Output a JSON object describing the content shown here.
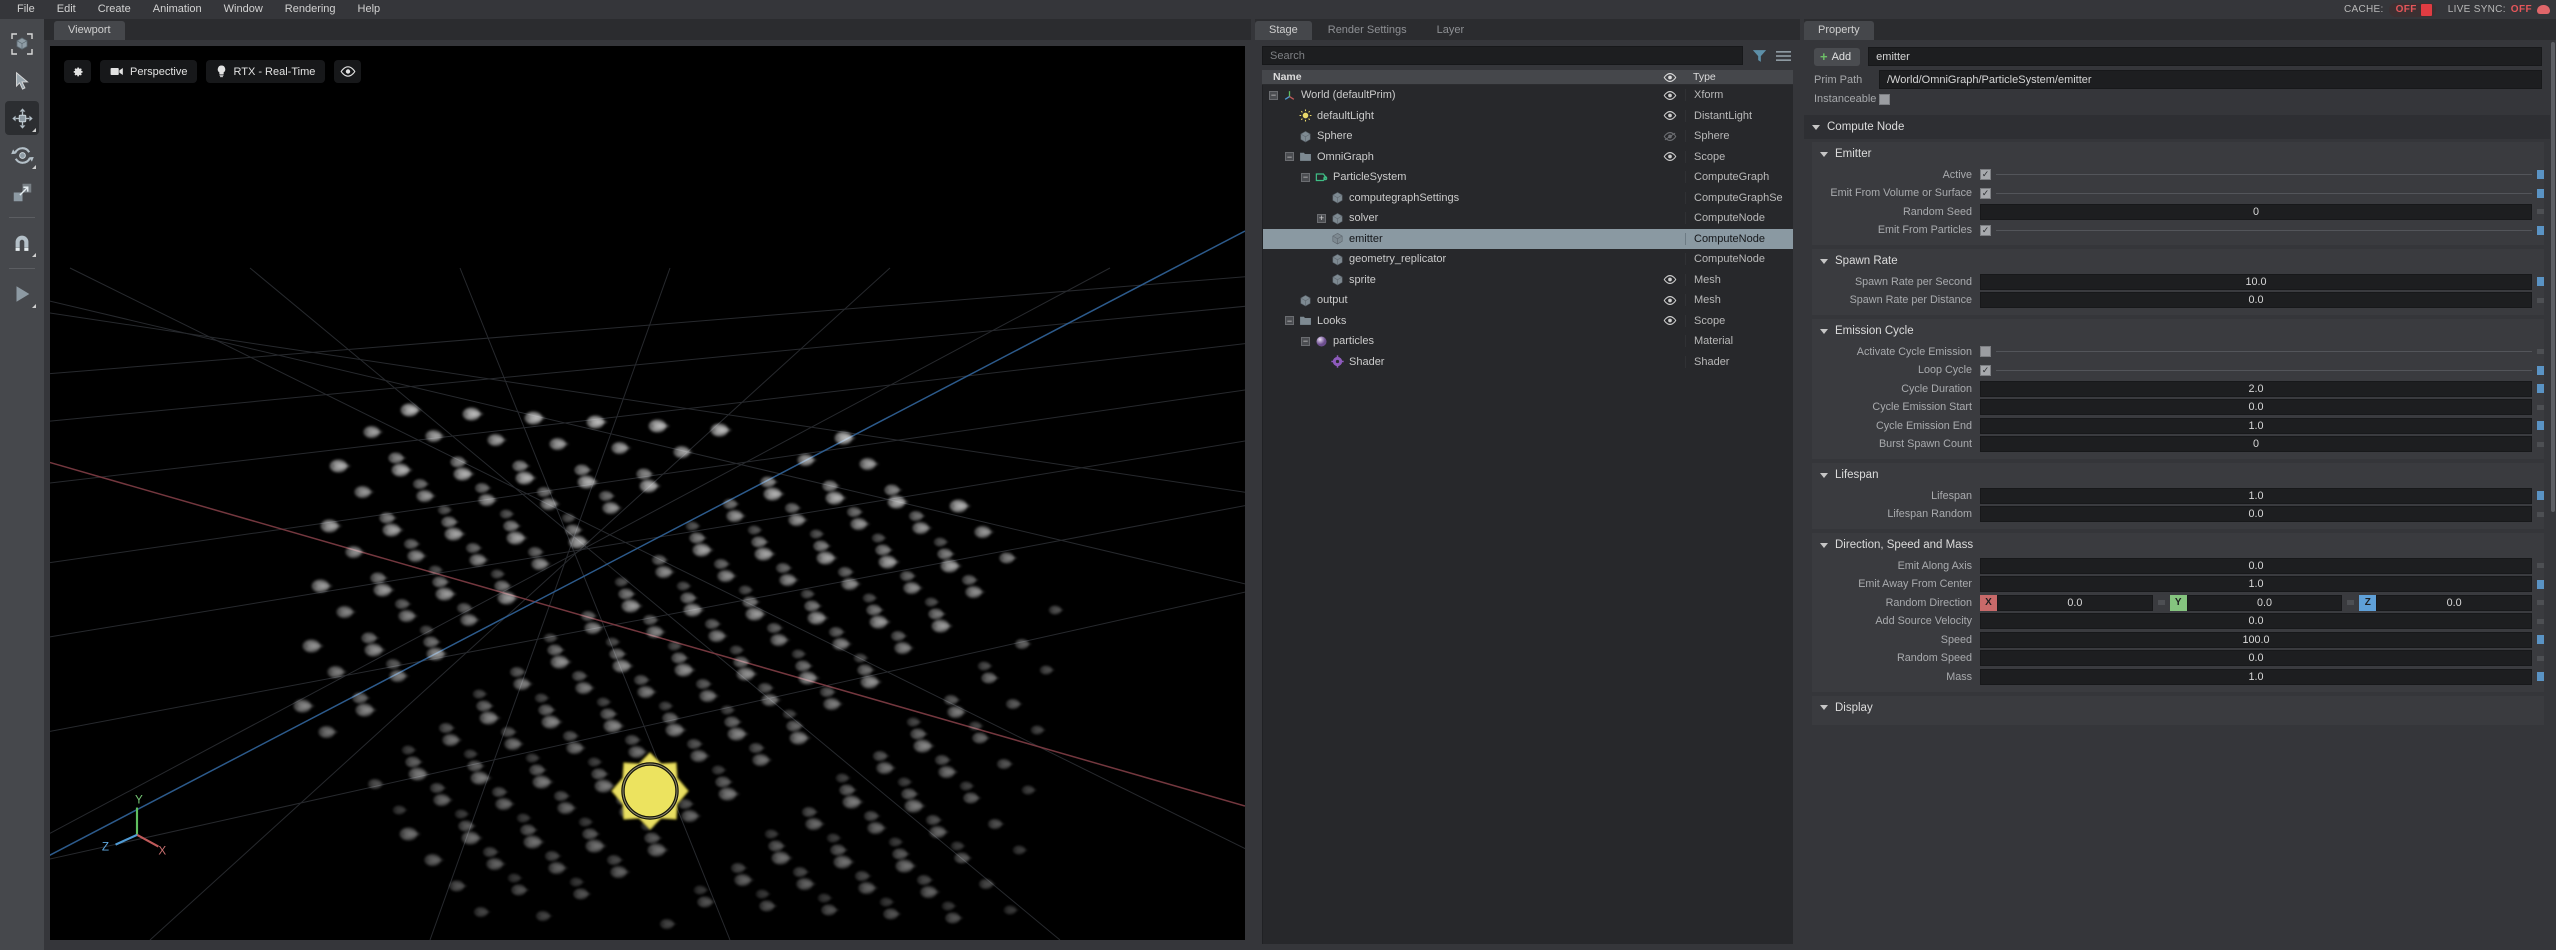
{
  "menubar": {
    "items": [
      "File",
      "Edit",
      "Create",
      "Animation",
      "Window",
      "Rendering",
      "Help"
    ],
    "cache_label": "CACHE:",
    "cache_value": "OFF",
    "livesync_label": "LIVE SYNC:",
    "livesync_value": "OFF"
  },
  "viewport": {
    "tab": "Viewport",
    "toolbar": {
      "settings_icon": "gear-icon",
      "camera_label": "Perspective",
      "renderer_label": "RTX - Real-Time",
      "visibility_icon": "eye-icon"
    },
    "axis": {
      "x": "X",
      "y": "Y",
      "z": "Z"
    }
  },
  "rail": {
    "items": [
      {
        "name": "select-bounds-tool",
        "icon": "cube-bracket-icon"
      },
      {
        "name": "pointer-tool",
        "icon": "cursor-arrow-icon"
      },
      {
        "name": "move-tool",
        "icon": "move-gizmo-icon"
      },
      {
        "name": "rotate-tool",
        "icon": "rotate-gizmo-icon"
      },
      {
        "name": "scale-tool",
        "icon": "scale-gizmo-icon"
      },
      {
        "name": "snap-tool",
        "icon": "magnet-icon"
      },
      {
        "name": "play-tool",
        "icon": "play-icon"
      }
    ]
  },
  "stage": {
    "tabs": [
      {
        "label": "Stage",
        "active": true
      },
      {
        "label": "Render Settings",
        "active": false
      },
      {
        "label": "Layer",
        "active": false
      }
    ],
    "search": {
      "placeholder": "Search",
      "value": ""
    },
    "filter_icon": "filter-funnel-icon",
    "options_icon": "hamburger-menu-icon",
    "columns": {
      "name": "Name",
      "eye": "eye-icon",
      "type": "Type"
    },
    "rows": [
      {
        "label": "World (defaultPrim)",
        "type": "Xform",
        "indent": 0,
        "expander": "minus",
        "icon": "axis-tripod-icon",
        "eye": "visible",
        "selected": false
      },
      {
        "label": "defaultLight",
        "type": "DistantLight",
        "indent": 1,
        "expander": "none",
        "icon": "light-icon",
        "eye": "visible",
        "selected": false
      },
      {
        "label": "Sphere",
        "type": "Sphere",
        "indent": 1,
        "expander": "none",
        "icon": "mesh-cube-icon",
        "eye": "hidden",
        "selected": false
      },
      {
        "label": "OmniGraph",
        "type": "Scope",
        "indent": 1,
        "expander": "minus",
        "icon": "folder-icon",
        "eye": "visible",
        "selected": false
      },
      {
        "label": "ParticleSystem",
        "type": "ComputeGraph",
        "indent": 2,
        "expander": "minus",
        "icon": "graph-icon",
        "eye": "none",
        "selected": false
      },
      {
        "label": "computegraphSettings",
        "type": "ComputeGraphSe",
        "indent": 3,
        "expander": "none",
        "icon": "mesh-cube-icon",
        "eye": "none",
        "selected": false
      },
      {
        "label": "solver",
        "type": "ComputeNode",
        "indent": 3,
        "expander": "plus",
        "icon": "mesh-cube-icon",
        "eye": "none",
        "selected": false
      },
      {
        "label": "emitter",
        "type": "ComputeNode",
        "indent": 3,
        "expander": "none",
        "icon": "mesh-cube-icon",
        "eye": "none",
        "selected": true
      },
      {
        "label": "geometry_replicator",
        "type": "ComputeNode",
        "indent": 3,
        "expander": "none",
        "icon": "mesh-cube-icon",
        "eye": "none",
        "selected": false
      },
      {
        "label": "sprite",
        "type": "Mesh",
        "indent": 3,
        "expander": "none",
        "icon": "mesh-cube-icon",
        "eye": "visible",
        "selected": false
      },
      {
        "label": "output",
        "type": "Mesh",
        "indent": 1,
        "expander": "none",
        "icon": "mesh-cube-icon",
        "eye": "visible",
        "selected": false
      },
      {
        "label": "Looks",
        "type": "Scope",
        "indent": 1,
        "expander": "minus",
        "icon": "folder-icon",
        "eye": "visible",
        "selected": false
      },
      {
        "label": "particles",
        "type": "Material",
        "indent": 2,
        "expander": "minus",
        "icon": "material-sphere-icon",
        "eye": "none",
        "selected": false
      },
      {
        "label": "Shader",
        "type": "Shader",
        "indent": 3,
        "expander": "none",
        "icon": "shader-gear-icon",
        "eye": "none",
        "selected": false
      }
    ]
  },
  "property": {
    "tab": "Property",
    "add_button": "Add",
    "name_value": "emitter",
    "prim_path_label": "Prim Path",
    "prim_path_value": "/World/OmniGraph/ParticleSystem/emitter",
    "instanceable_label": "Instanceable",
    "instanceable_checked": false,
    "compute_node_title": "Compute Node",
    "sections": [
      {
        "title": "Emitter",
        "rows": [
          {
            "label": "Active",
            "kind": "bool",
            "value": true,
            "connected": true
          },
          {
            "label": "Emit From Volume or Surface",
            "kind": "bool",
            "value": true,
            "connected": true
          },
          {
            "label": "Random Seed",
            "kind": "number",
            "value": "0",
            "connected": false
          },
          {
            "label": "Emit From Particles",
            "kind": "bool",
            "value": true,
            "connected": true
          }
        ]
      },
      {
        "title": "Spawn Rate",
        "rows": [
          {
            "label": "Spawn Rate per Second",
            "kind": "number",
            "value": "10.0",
            "connected": true
          },
          {
            "label": "Spawn Rate per Distance",
            "kind": "number",
            "value": "0.0",
            "connected": false
          }
        ]
      },
      {
        "title": "Emission Cycle",
        "rows": [
          {
            "label": "Activate Cycle Emission",
            "kind": "bool",
            "value": false,
            "connected": false
          },
          {
            "label": "Loop Cycle",
            "kind": "bool",
            "value": true,
            "connected": true
          },
          {
            "label": "Cycle Duration",
            "kind": "number",
            "value": "2.0",
            "connected": true
          },
          {
            "label": "Cycle Emission Start",
            "kind": "number",
            "value": "0.0",
            "connected": false
          },
          {
            "label": "Cycle Emission End",
            "kind": "number",
            "value": "1.0",
            "connected": true
          },
          {
            "label": "Burst Spawn Count",
            "kind": "number",
            "value": "0",
            "connected": false
          }
        ]
      },
      {
        "title": "Lifespan",
        "rows": [
          {
            "label": "Lifespan",
            "kind": "number",
            "value": "1.0",
            "connected": true
          },
          {
            "label": "Lifespan Random",
            "kind": "number",
            "value": "0.0",
            "connected": false
          }
        ]
      },
      {
        "title": "Direction, Speed and Mass",
        "rows": [
          {
            "label": "Emit Along Axis",
            "kind": "number",
            "value": "0.0",
            "connected": false
          },
          {
            "label": "Emit Away From Center",
            "kind": "number",
            "value": "1.0",
            "connected": true
          },
          {
            "label": "Random Direction",
            "kind": "vector3",
            "axes": [
              "X",
              "Y",
              "Z"
            ],
            "values": [
              "0.0",
              "0.0",
              "0.0"
            ],
            "connected": false
          },
          {
            "label": "Add Source Velocity",
            "kind": "number",
            "value": "0.0",
            "connected": false
          },
          {
            "label": "Speed",
            "kind": "number",
            "value": "100.0",
            "connected": true
          },
          {
            "label": "Random Speed",
            "kind": "number",
            "value": "0.0",
            "connected": false
          },
          {
            "label": "Mass",
            "kind": "number",
            "value": "1.0",
            "connected": true
          }
        ]
      },
      {
        "title": "Display",
        "rows": []
      }
    ]
  },
  "colors": {
    "accent_blue": "#5a93c4",
    "axis_x": "#c86a6a",
    "axis_y": "#85c47f",
    "axis_z": "#5fa0d8",
    "selection": "#8a99a2",
    "status_red": "#e4565a",
    "add_green": "#6dbf67"
  }
}
